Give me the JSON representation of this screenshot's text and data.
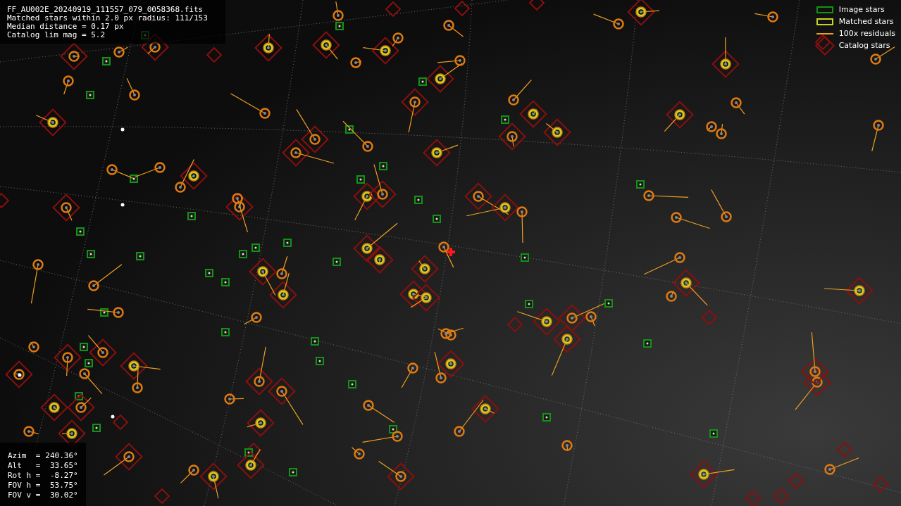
{
  "info": {
    "lines": [
      "FF_AU002E_20240919_111557_079_0058368.fits",
      "Matched stars within 2.0 px radius: 111/153",
      "Median distance = 0.17 px",
      "Catalog lim mag = 5.2"
    ]
  },
  "legend": [
    {
      "kind": "image",
      "label": "Image stars"
    },
    {
      "kind": "matched",
      "label": "Matched stars"
    },
    {
      "kind": "residual",
      "label": "100x residuals"
    },
    {
      "kind": "catalog",
      "label": "Catalog stars"
    }
  ],
  "pointing": [
    {
      "label": "Azim  =",
      "value": "240.36°"
    },
    {
      "label": "Alt   =",
      "value": " 33.65°"
    },
    {
      "label": "Rot h =",
      "value": " -8.27°"
    },
    {
      "label": "FOV h =",
      "value": " 53.75°"
    },
    {
      "label": "FOV v =",
      "value": " 30.02°"
    }
  ]
}
